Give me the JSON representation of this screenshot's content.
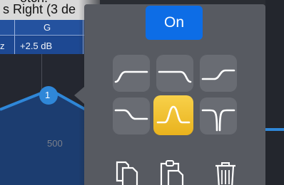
{
  "background": {
    "title_partial": "s Right (3 de",
    "top_clip_partial": "otch.",
    "table": {
      "header_g": "G",
      "row_prefix": "z",
      "gain_value": "+2.5 dB"
    },
    "axis_label": "500",
    "band_node_label": "1"
  },
  "popover": {
    "on_label": "On",
    "filters": [
      {
        "name": "high-pass",
        "selected": false
      },
      {
        "name": "low-pass",
        "selected": false
      },
      {
        "name": "high-shelf",
        "selected": false
      },
      {
        "name": "low-shelf",
        "selected": false
      },
      {
        "name": "bell",
        "selected": true
      },
      {
        "name": "notch",
        "selected": false
      }
    ],
    "tools": [
      {
        "name": "copy-icon"
      },
      {
        "name": "paste-icon"
      },
      {
        "name": "trash-icon"
      }
    ]
  },
  "colors": {
    "accent_blue": "#0d6de6",
    "selected_yellow": "#f0c02c",
    "popover_bg": "#575a61",
    "node_blue": "#2f87d8"
  }
}
